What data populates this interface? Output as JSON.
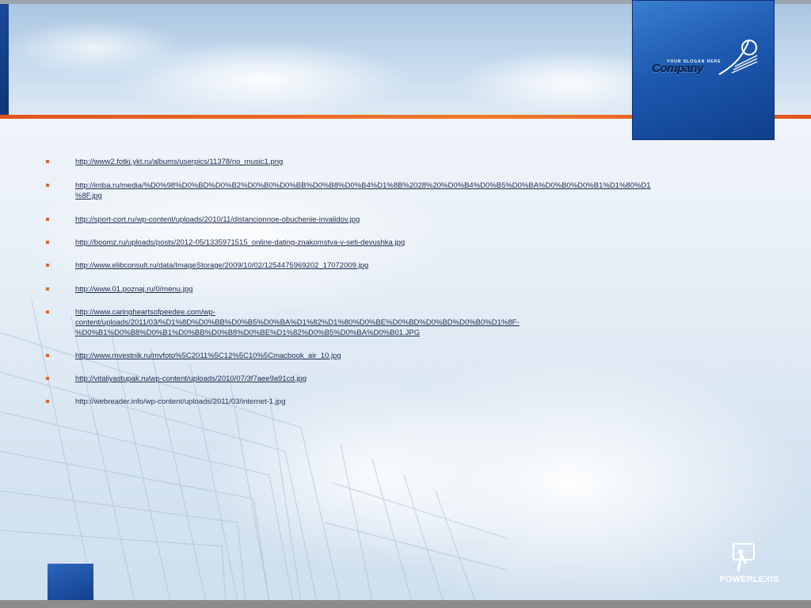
{
  "logo": {
    "slogan": "YOUR SLOGAN HERE",
    "name": "Company"
  },
  "watermark": {
    "brand": "POWERLEXIS"
  },
  "colors": {
    "accent_orange": "#e2541c",
    "logo_blue": "#1d59b0",
    "bullet": "#d9692a",
    "link_text": "#1d2b4d"
  },
  "links": [
    {
      "lines": [
        "http://www2.fotki.ykt.ru/albums/userpics/11378/no_music1.png"
      ],
      "underlined": true
    },
    {
      "lines": [
        "http://imba.ru/media/%D0%98%D0%BD%D0%B2%D0%B0%D0%BB%D0%B8%D0%B4%D1%8B%2028%20%D0%B4%D0%B5%D0%BA%D0%B0%D0%B1%D1%80%D1",
        "%8F.jpg"
      ],
      "underlined": true
    },
    {
      "lines": [
        "http://sport-cort.ru/wp-content/uploads/2010/11/distancionnoe-obuchenie-invalidov.jpg"
      ],
      "underlined": true
    },
    {
      "lines": [
        "http://boomz.ru/uploads/posts/2012-05/1335971515_online-dating-znakomstva-v-seti-devushka.jpg"
      ],
      "underlined": true
    },
    {
      "lines": [
        "http://www.elibconsult.ru/data/ImageStorage/2009/10/02/1254475969202_17072009.jpg"
      ],
      "underlined": true
    },
    {
      "lines": [
        "http://www.01.poznaj.ru/0/menu.jpg"
      ],
      "underlined": true
    },
    {
      "lines": [
        "http://www.caringheartsofpeedee.com/wp-",
        "content/uploads/2011/03/%D1%8D%D0%BB%D0%B5%D0%BA%D1%82%D1%80%D0%BE%D0%BD%D0%BD%D0%B0%D1%8F-",
        "%D0%B1%D0%B8%D0%B1%D0%BB%D0%B8%D0%BE%D1%82%D0%B5%D0%BA%D0%B01.JPG"
      ],
      "underlined": true
    },
    {
      "lines": [
        "http://www.mvestnik.ru/mvfoto%5C2011%5C12%5C10%5Cmacbook_air_10.jpg"
      ],
      "underlined": true
    },
    {
      "lines": [
        "http://vitaliyastupak.ru/wp-content/uploads/2010/07/3f7aee9a91cd.jpg"
      ],
      "underlined": true
    },
    {
      "lines": [
        "http://webreader.info/wp-content/uploads/2011/03/internet-1.jpg"
      ],
      "underlined": false
    }
  ]
}
